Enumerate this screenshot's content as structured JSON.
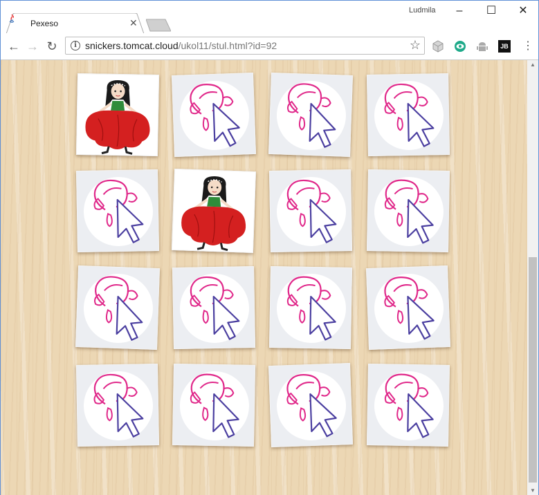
{
  "browser": {
    "tab_title": "Pexeso",
    "profile_name": "Ludmila",
    "url_host": "snickers.tomcat.cloud",
    "url_path": "/ukol11/stul.html?id=92",
    "extensions": [
      "cube-icon",
      "eye-icon",
      "android-icon",
      "jb-icon"
    ],
    "ext_jb_label": "JB"
  },
  "board": {
    "rows": 4,
    "cols": 4,
    "cards": [
      {
        "state": "face",
        "picture": "girl-red-dress"
      },
      {
        "state": "back"
      },
      {
        "state": "back"
      },
      {
        "state": "back"
      },
      {
        "state": "back"
      },
      {
        "state": "face",
        "picture": "girl-red-dress"
      },
      {
        "state": "back"
      },
      {
        "state": "back"
      },
      {
        "state": "back"
      },
      {
        "state": "back"
      },
      {
        "state": "back"
      },
      {
        "state": "back"
      },
      {
        "state": "back"
      },
      {
        "state": "back"
      },
      {
        "state": "back"
      },
      {
        "state": "back"
      }
    ]
  },
  "colors": {
    "card_back_pink": "#e0288a",
    "card_back_arrow": "#4b3fa0",
    "dress_red": "#d42020",
    "hair_black": "#1a1a1a"
  }
}
